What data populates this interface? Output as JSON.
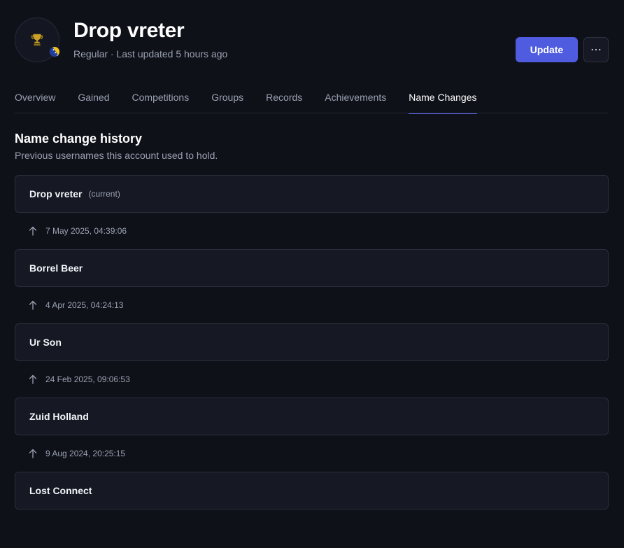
{
  "player": {
    "name": "Drop vreter",
    "subtitle": "Regular · Last updated 5 hours ago",
    "avatar_icon": "trophy-icon",
    "flag_icon": "bosnia-flag-icon"
  },
  "actions": {
    "update_label": "Update",
    "more_label": "⋯"
  },
  "tabs": [
    {
      "label": "Overview",
      "active": false
    },
    {
      "label": "Gained",
      "active": false
    },
    {
      "label": "Competitions",
      "active": false
    },
    {
      "label": "Groups",
      "active": false
    },
    {
      "label": "Records",
      "active": false
    },
    {
      "label": "Achievements",
      "active": false
    },
    {
      "label": "Name Changes",
      "active": true
    }
  ],
  "section": {
    "title": "Name change history",
    "description": "Previous usernames this account used to hold."
  },
  "history": {
    "names": [
      {
        "name": "Drop vreter",
        "tag": "(current)"
      },
      {
        "name": "Borrel Beer"
      },
      {
        "name": "Ur Son"
      },
      {
        "name": "Zuid Holland"
      },
      {
        "name": "Lost Connect"
      }
    ],
    "changes": [
      {
        "date": "7 May 2025, 04:39:06"
      },
      {
        "date": "4 Apr 2025, 04:24:13"
      },
      {
        "date": "24 Feb 2025, 09:06:53"
      },
      {
        "date": "9 Aug 2024, 20:25:15"
      }
    ]
  },
  "colors": {
    "background": "#0f1118",
    "card": "#161923",
    "accent": "#4f5ce0",
    "muted_text": "#9aa1b3"
  }
}
